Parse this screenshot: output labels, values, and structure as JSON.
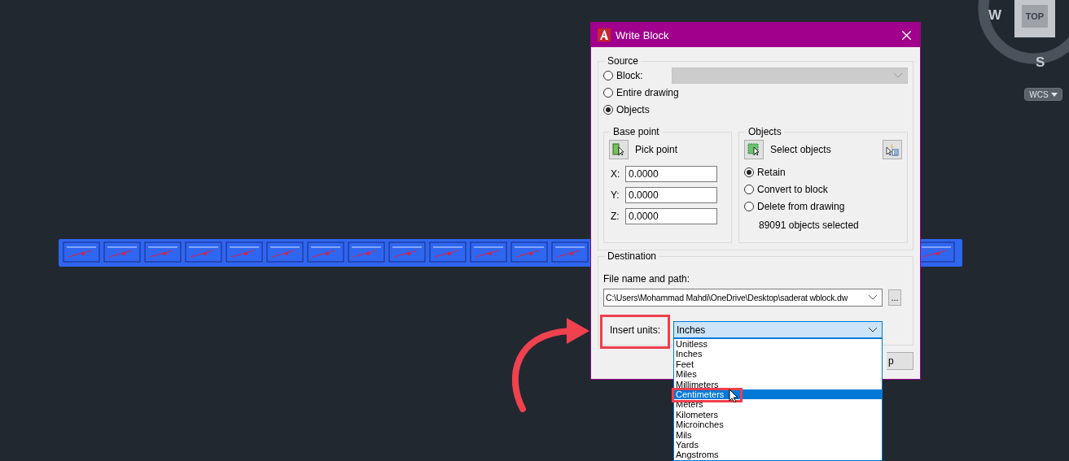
{
  "view_cube": {
    "west": "W",
    "face": "TOP",
    "south": "S"
  },
  "ucs_menu": {
    "label": "WCS"
  },
  "dialog": {
    "title": "Write Block",
    "source": {
      "label": "Source",
      "options": [
        {
          "label": "Block:",
          "selected": false
        },
        {
          "label": "Entire drawing",
          "selected": false
        },
        {
          "label": "Objects",
          "selected": true
        }
      ],
      "block_field": {
        "disabled": true
      }
    },
    "base_point": {
      "label": "Base point",
      "pick_button": "Pick point",
      "coords": [
        {
          "axis": "X:",
          "value": "0.0000"
        },
        {
          "axis": "Y:",
          "value": "0.0000"
        },
        {
          "axis": "Z:",
          "value": "0.0000"
        }
      ]
    },
    "objects": {
      "label": "Objects",
      "select_button": "Select objects",
      "modes": [
        {
          "label": "Retain",
          "selected": true
        },
        {
          "label": "Convert to block",
          "selected": false
        },
        {
          "label": "Delete from drawing",
          "selected": false
        }
      ],
      "count": "89091 objects selected"
    },
    "destination": {
      "label": "Destination",
      "file_label": "File name and path:",
      "file_value": "C:\\Users\\Mohammad Mahdi\\OneDrive\\Desktop\\saderat wblock.dw",
      "browse": "...",
      "units_label": "Insert units:",
      "units": {
        "value": "Inches",
        "expanded": true,
        "items": [
          {
            "label": "Unitless",
            "highlighted": false
          },
          {
            "label": "Inches",
            "highlighted": false
          },
          {
            "label": "Feet",
            "highlighted": false
          },
          {
            "label": "Miles",
            "highlighted": false
          },
          {
            "label": "Millimeters",
            "highlighted": false
          },
          {
            "label": "Centimeters",
            "highlighted": true
          },
          {
            "label": "Meters",
            "highlighted": false
          },
          {
            "label": "Kilometers",
            "highlighted": false
          },
          {
            "label": "Microinches",
            "highlighted": false
          },
          {
            "label": "Mils",
            "highlighted": false
          },
          {
            "label": "Yards",
            "highlighted": false
          },
          {
            "label": "Angstroms",
            "highlighted": false
          }
        ]
      }
    },
    "help_button": "p"
  }
}
